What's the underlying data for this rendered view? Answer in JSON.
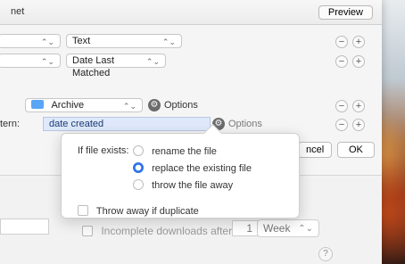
{
  "window": {
    "title_fragment": "net",
    "preview_label": "Preview"
  },
  "rows": {
    "row1": {
      "popup_left_value": "",
      "popup_right_value": "Text"
    },
    "row2": {
      "popup_left_value": "",
      "popup_right_value": "Date Last Matched"
    },
    "archive": {
      "folder_value": "Archive",
      "options_label": "Options"
    },
    "pattern": {
      "label": "tern:",
      "value": "date created",
      "options_label": "Options"
    }
  },
  "dialog_buttons": {
    "cancel_label": "ncel",
    "ok_label": "OK"
  },
  "popover": {
    "if_file_exists_label": "If file exists:",
    "options": [
      {
        "label": "rename the file",
        "selected": false
      },
      {
        "label": "replace the existing file",
        "selected": true
      },
      {
        "label": "throw the file away",
        "selected": false
      }
    ],
    "throw_away_if_duplicate": {
      "label": "Throw away if duplicate",
      "checked": false
    }
  },
  "lower_settings": {
    "incomplete_downloads_label": "Incomplete downloads after",
    "incomplete_downloads_value": "1",
    "incomplete_downloads_unit": "Week",
    "help_symbol": "?"
  },
  "icons": {
    "chevrons": "chevron-updown-icon",
    "minus": "minus-icon",
    "plus": "plus-icon",
    "gear": "gear-icon",
    "folder": "folder-icon"
  }
}
